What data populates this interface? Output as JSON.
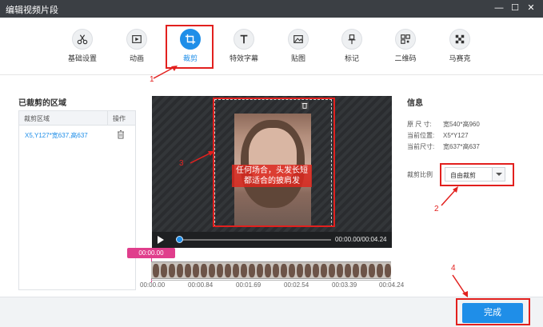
{
  "window": {
    "title": "编辑视频片段",
    "minimize": "—",
    "maximize": "☐",
    "close": "✕"
  },
  "toolbar": {
    "items": [
      {
        "label": "基础设置",
        "icon": "scissors-icon"
      },
      {
        "label": "动画",
        "icon": "film-icon"
      },
      {
        "label": "裁剪",
        "icon": "crop-icon",
        "active": true
      },
      {
        "label": "特效字幕",
        "icon": "text-icon"
      },
      {
        "label": "贴图",
        "icon": "image-icon"
      },
      {
        "label": "标记",
        "icon": "pin-icon"
      },
      {
        "label": "二维码",
        "icon": "qrcode-icon"
      },
      {
        "label": "马赛克",
        "icon": "mosaic-icon"
      }
    ]
  },
  "left_panel": {
    "title": "已裁剪的区域",
    "columns": [
      "裁剪区域",
      "操作"
    ],
    "rows": [
      {
        "area": "X5,Y127*宽637,高637"
      }
    ]
  },
  "preview": {
    "caption_line1": "任何场合，头发长短",
    "caption_line2": "都适合的披肩发",
    "timecode": "00:00.00/00:04.24",
    "progress_fraction": 0.0
  },
  "info": {
    "title": "信息",
    "original_size_label": "原 尺 寸:",
    "original_size": "宽540*高960",
    "position_label": "当前位置:",
    "position": "X5*Y127",
    "current_size_label": "当前尺寸:",
    "current_size": "宽637*高637",
    "ratio_label": "裁剪比例",
    "ratio_value": "自由裁剪"
  },
  "timeline": {
    "marker": "00:00.00",
    "ticks": [
      "00:00.00",
      "00:00.84",
      "00:01.69",
      "00:02.54",
      "00:03.39",
      "00:04.24"
    ]
  },
  "footer": {
    "done_label": "完成"
  },
  "annotations": {
    "n1": "1",
    "n2": "2",
    "n3": "3",
    "n4": "4",
    "color": "#e2201e"
  },
  "colors": {
    "accent": "#1f8ee8",
    "marker": "#e03e8c",
    "titlebar": "#3b3f44"
  }
}
